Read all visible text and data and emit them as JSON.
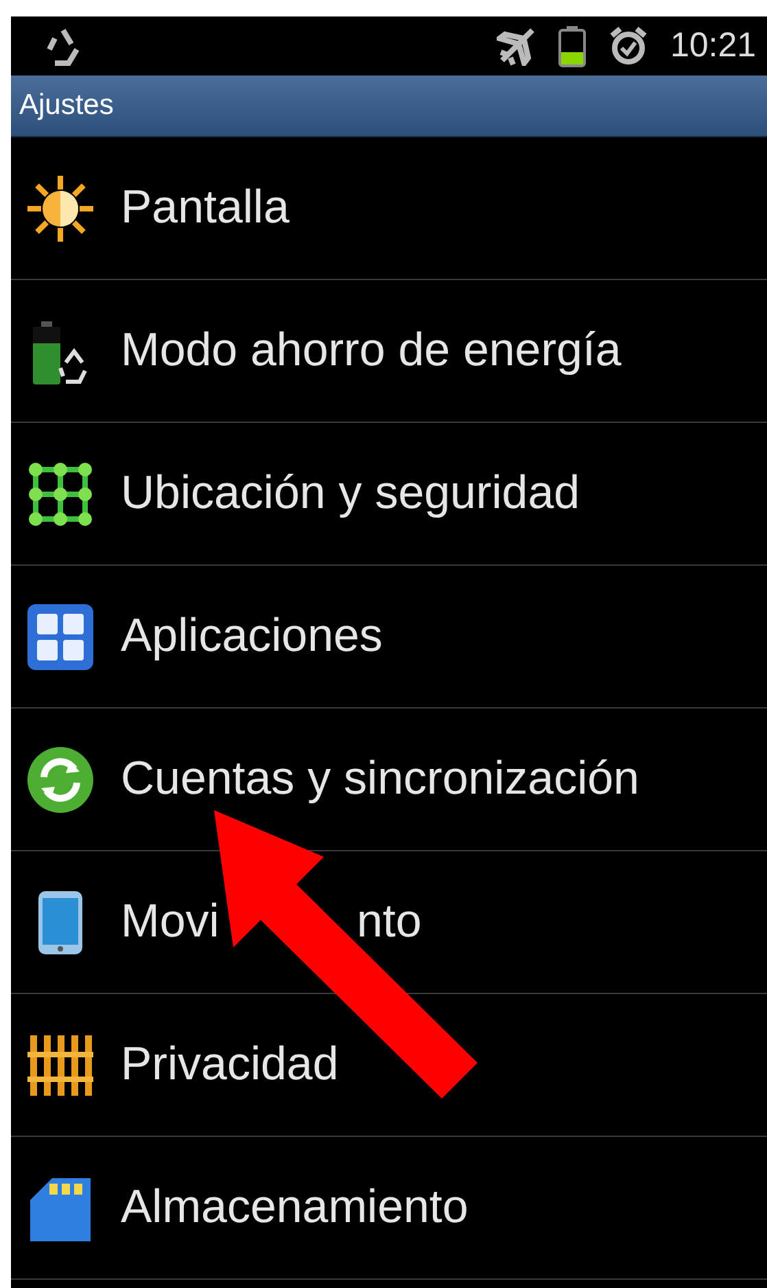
{
  "status_bar": {
    "time": "10:21"
  },
  "title_bar": {
    "title": "Ajustes"
  },
  "settings": [
    {
      "label": "Pantalla",
      "kind": "display"
    },
    {
      "label": "Modo ahorro de energía",
      "kind": "power"
    },
    {
      "label": "Ubicación y seguridad",
      "kind": "location"
    },
    {
      "label": "Aplicaciones",
      "kind": "apps"
    },
    {
      "label": "Cuentas y sincronización",
      "kind": "sync"
    },
    {
      "label": "Movi",
      "label_end": "nto",
      "kind": "motion"
    },
    {
      "label": "Privacidad",
      "kind": "privacy"
    },
    {
      "label": "Almacenamiento",
      "kind": "storage"
    }
  ]
}
